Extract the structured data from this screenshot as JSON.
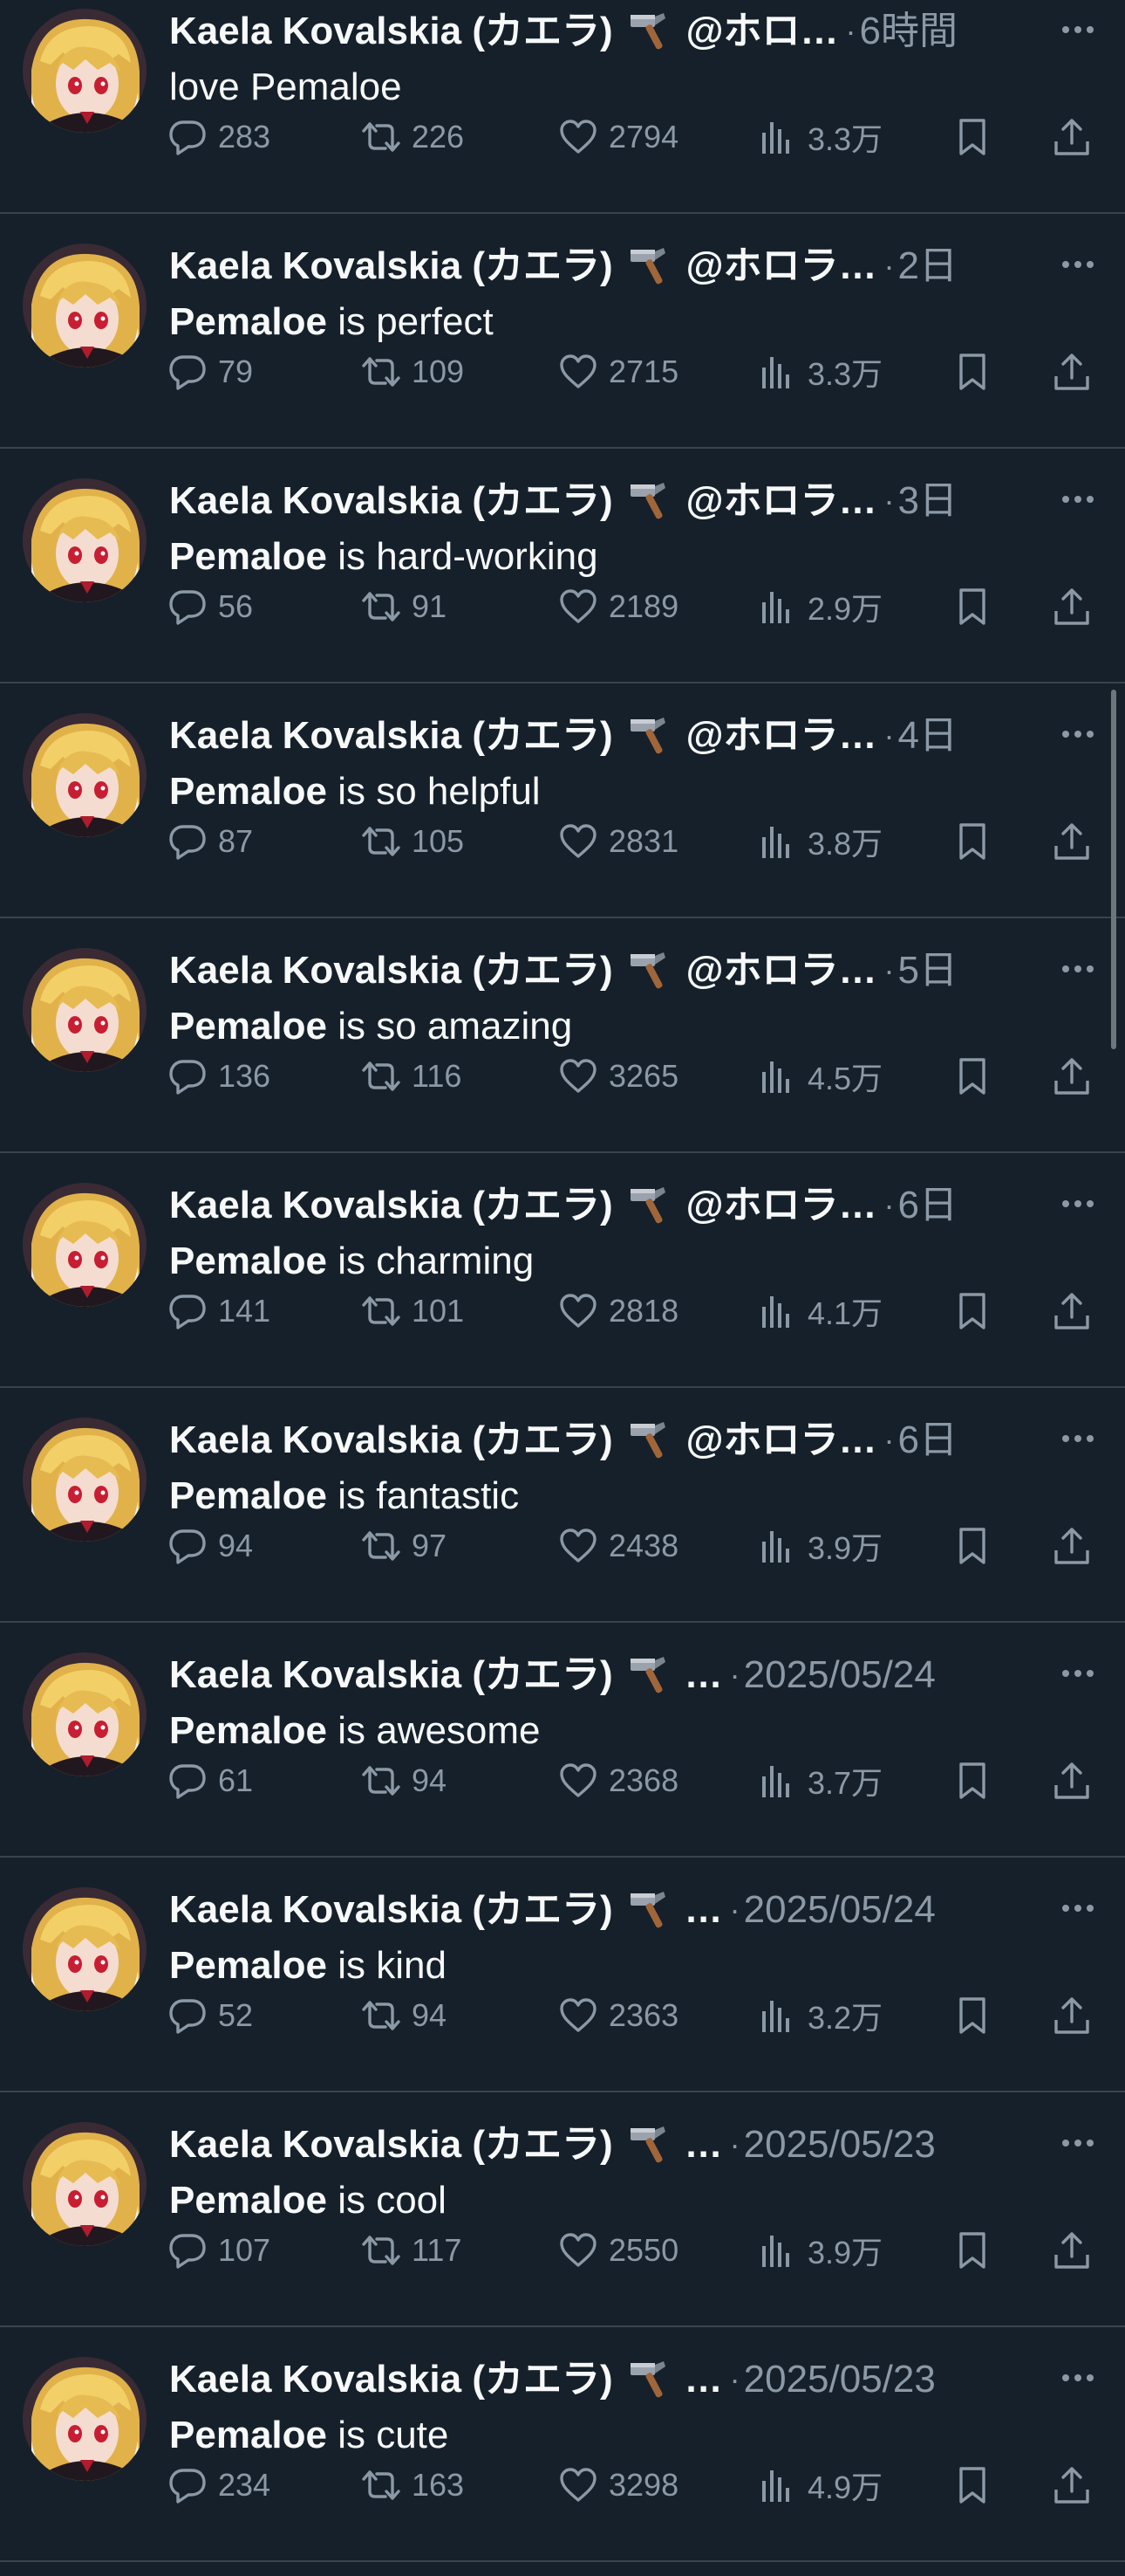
{
  "accent_colors": {
    "background": "#15202b",
    "text_primary": "#f7f9f9",
    "text_secondary": "#8b98a5",
    "divider": "#38444d"
  },
  "icons": {
    "reply": "speech-bubble-icon",
    "retweet": "retweet-arrows-icon",
    "like": "heart-icon",
    "views": "bar-chart-icon",
    "bookmark": "bookmark-icon",
    "share": "share-upload-icon",
    "more": "ellipsis-icon",
    "name_emoji": "hammer-icon"
  },
  "tweets": [
    {
      "name": "Kaela Kovalskia (カエラ)",
      "handle": "@ホロ…",
      "time": "6時間",
      "text_bold": "",
      "text_prefix": "love ",
      "text_after": "Pemaloe",
      "replies": "283",
      "retweets": "226",
      "likes": "2794",
      "views": "3.3万"
    },
    {
      "name": "Kaela Kovalskia (カエラ)",
      "handle": "@ホロラ…",
      "time": "2日",
      "text_bold": "Pemaloe",
      "text_prefix": "",
      "text_after": " is perfect",
      "replies": "79",
      "retweets": "109",
      "likes": "2715",
      "views": "3.3万"
    },
    {
      "name": "Kaela Kovalskia (カエラ)",
      "handle": "@ホロラ…",
      "time": "3日",
      "text_bold": "Pemaloe",
      "text_prefix": "",
      "text_after": " is hard-working",
      "replies": "56",
      "retweets": "91",
      "likes": "2189",
      "views": "2.9万"
    },
    {
      "name": "Kaela Kovalskia (カエラ)",
      "handle": "@ホロラ…",
      "time": "4日",
      "text_bold": "Pemaloe",
      "text_prefix": "",
      "text_after": " is so helpful",
      "replies": "87",
      "retweets": "105",
      "likes": "2831",
      "views": "3.8万"
    },
    {
      "name": "Kaela Kovalskia (カエラ)",
      "handle": "@ホロラ…",
      "time": "5日",
      "text_bold": "Pemaloe",
      "text_prefix": "",
      "text_after": " is so amazing",
      "replies": "136",
      "retweets": "116",
      "likes": "3265",
      "views": "4.5万"
    },
    {
      "name": "Kaela Kovalskia (カエラ)",
      "handle": "@ホロラ…",
      "time": "6日",
      "text_bold": "Pemaloe",
      "text_prefix": "",
      "text_after": " is charming",
      "replies": "141",
      "retweets": "101",
      "likes": "2818",
      "views": "4.1万"
    },
    {
      "name": "Kaela Kovalskia (カエラ)",
      "handle": "@ホロラ…",
      "time": "6日",
      "text_bold": "Pemaloe",
      "text_prefix": "",
      "text_after": " is fantastic",
      "replies": "94",
      "retweets": "97",
      "likes": "2438",
      "views": "3.9万"
    },
    {
      "name": "Kaela Kovalskia (カエラ)",
      "handle": "",
      "time": "2025/05/24",
      "text_bold": "Pemaloe",
      "text_prefix": "",
      "text_after": " is awesome",
      "replies": "61",
      "retweets": "94",
      "likes": "2368",
      "views": "3.7万"
    },
    {
      "name": "Kaela Kovalskia (カエラ)",
      "handle": "",
      "time": "2025/05/24",
      "text_bold": "Pemaloe",
      "text_prefix": "",
      "text_after": " is kind",
      "replies": "52",
      "retweets": "94",
      "likes": "2363",
      "views": "3.2万"
    },
    {
      "name": "Kaela Kovalskia (カエラ)",
      "handle": "",
      "time": "2025/05/23",
      "text_bold": "Pemaloe",
      "text_prefix": "",
      "text_after": " is cool",
      "replies": "107",
      "retweets": "117",
      "likes": "2550",
      "views": "3.9万"
    },
    {
      "name": "Kaela Kovalskia (カエラ)",
      "handle": "",
      "time": "2025/05/23",
      "text_bold": "Pemaloe",
      "text_prefix": "",
      "text_after": " is cute",
      "replies": "234",
      "retweets": "163",
      "likes": "3298",
      "views": "4.9万"
    }
  ]
}
